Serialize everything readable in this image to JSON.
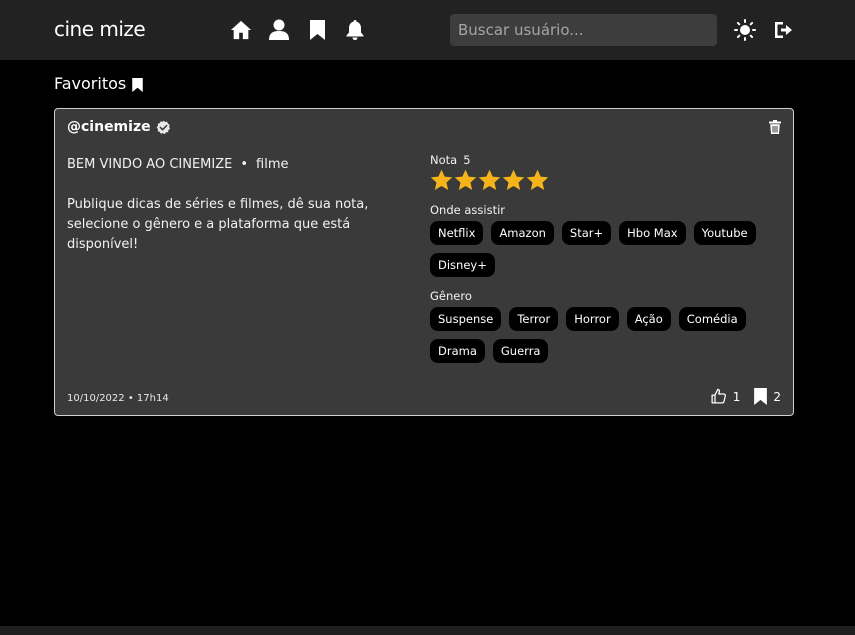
{
  "header": {
    "logo": "cine mize",
    "search_placeholder": "Buscar usuário...",
    "icons": [
      "home-icon",
      "profile-icon",
      "bookmark-icon",
      "bell-icon",
      "sun-icon",
      "logout-icon"
    ]
  },
  "page": {
    "section_title": "Favoritos"
  },
  "post": {
    "author": "@cinemize",
    "title": "BEM VINDO AO CINEMIZE",
    "separator": "•",
    "type": "filme",
    "body": "Publique dicas de séries e filmes, dê sua nota, selecione o gênero e a plataforma que está disponível!",
    "rating_label": "Nota",
    "rating_value": "5",
    "stars": 5,
    "where_label": "Onde assistir",
    "platforms": [
      "Netflix",
      "Amazon",
      "Star+",
      "Hbo Max",
      "Youtube",
      "Disney+"
    ],
    "genre_label": "Gênero",
    "genres": [
      "Suspense",
      "Terror",
      "Horror",
      "Ação",
      "Comédia",
      "Drama",
      "Guerra"
    ],
    "date": "10/10/2022 • 17h14",
    "likes": "1",
    "saves": "2"
  },
  "colors": {
    "background": "#000000",
    "header": "#222222",
    "card": "#3a3a3a",
    "star": "#f4b41a",
    "chip": "#000000"
  }
}
